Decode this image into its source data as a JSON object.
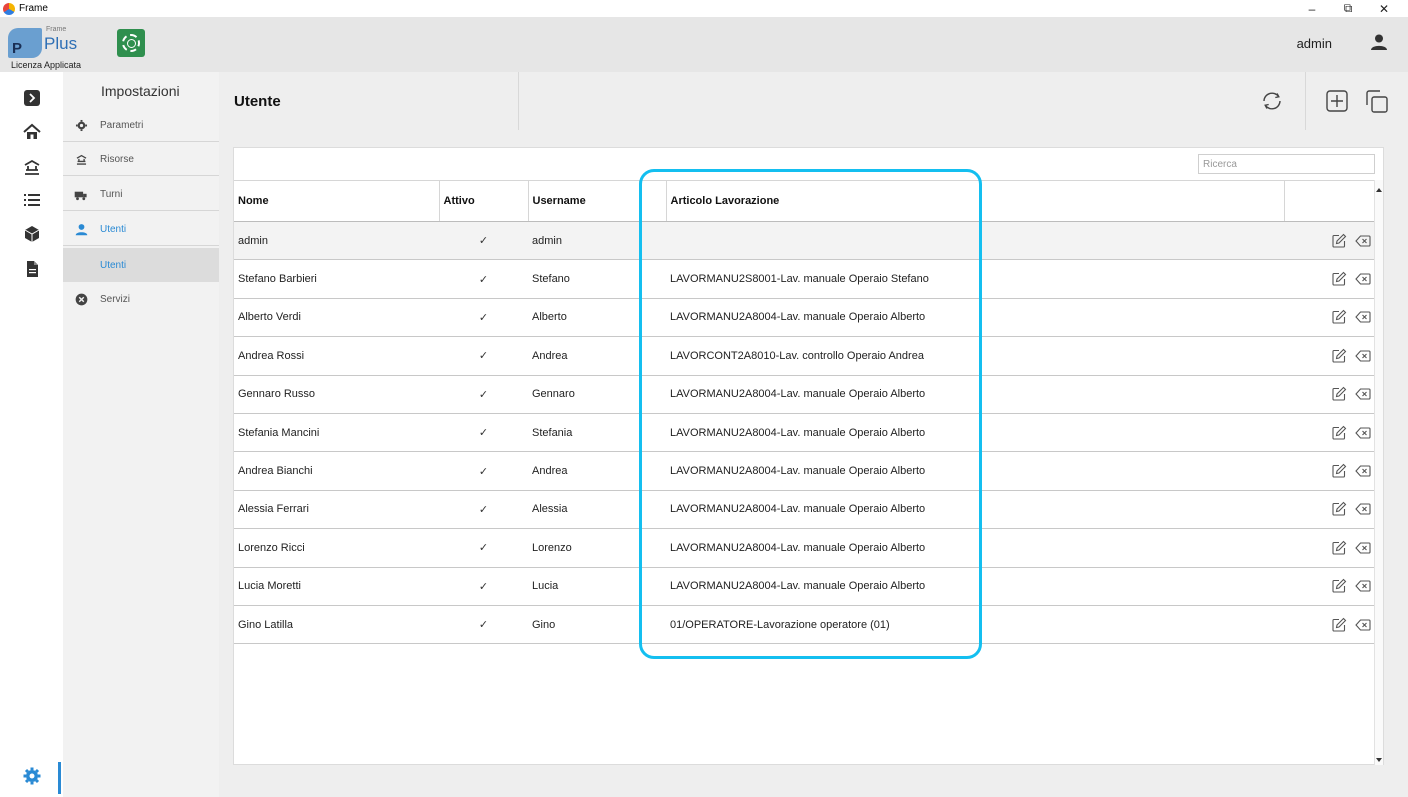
{
  "window": {
    "title": "Frame",
    "icon": "app-icon",
    "controls": {
      "minimize": "–",
      "restore": "⧉",
      "close": "✕"
    }
  },
  "header": {
    "logo_small": "Frame",
    "logo_letter": "P",
    "logo_text": "Plus",
    "license": "Licenza Applicata",
    "user_name": "admin",
    "green_button_icon": "wheel-icon",
    "user_icon": "user-icon"
  },
  "rail": {
    "icons": [
      "chevron-right-icon",
      "home-icon",
      "resources-icon",
      "list-icon",
      "box-icon",
      "document-icon"
    ],
    "bottom_icon": "gear-icon"
  },
  "submenu": {
    "title": "Impostazioni",
    "items": [
      {
        "label": "Parametri",
        "icon": "gear-icon"
      },
      {
        "label": "Risorse",
        "icon": "resources-icon"
      },
      {
        "label": "Turni",
        "icon": "shift-icon"
      },
      {
        "label": "Utenti",
        "icon": "user-icon"
      },
      {
        "label": "Servizi",
        "icon": "services-icon"
      }
    ],
    "sub_item": "Utenti"
  },
  "page": {
    "title": "Utente",
    "actions": [
      "refresh-icon",
      "add-icon",
      "copy-icon"
    ]
  },
  "search": {
    "placeholder": "Ricerca",
    "value": ""
  },
  "table": {
    "columns": [
      "Nome",
      "Attivo",
      "Username",
      "Articolo Lavorazione",
      ""
    ],
    "rows": [
      {
        "nome": "admin",
        "attivo": "✓",
        "username": "admin",
        "articolo": ""
      },
      {
        "nome": "Stefano Barbieri",
        "attivo": "✓",
        "username": "Stefano",
        "articolo": "LAVORMANU2S8001-Lav. manuale Operaio Stefano"
      },
      {
        "nome": "Alberto Verdi",
        "attivo": "✓",
        "username": "Alberto",
        "articolo": "LAVORMANU2A8004-Lav. manuale Operaio Alberto"
      },
      {
        "nome": "Andrea Rossi",
        "attivo": "✓",
        "username": "Andrea",
        "articolo": "LAVORCONT2A8010-Lav. controllo Operaio Andrea"
      },
      {
        "nome": "Gennaro Russo",
        "attivo": "✓",
        "username": "Gennaro",
        "articolo": "LAVORMANU2A8004-Lav. manuale Operaio Alberto"
      },
      {
        "nome": "Stefania Mancini",
        "attivo": "✓",
        "username": "Stefania",
        "articolo": "LAVORMANU2A8004-Lav. manuale Operaio Alberto"
      },
      {
        "nome": "Andrea Bianchi",
        "attivo": "✓",
        "username": "Andrea",
        "articolo": "LAVORMANU2A8004-Lav. manuale Operaio Alberto"
      },
      {
        "nome": "Alessia Ferrari",
        "attivo": "✓",
        "username": "Alessia",
        "articolo": "LAVORMANU2A8004-Lav. manuale Operaio Alberto"
      },
      {
        "nome": "Lorenzo Ricci",
        "attivo": "✓",
        "username": "Lorenzo",
        "articolo": "LAVORMANU2A8004-Lav. manuale Operaio Alberto"
      },
      {
        "nome": "Lucia Moretti",
        "attivo": "✓",
        "username": "Lucia",
        "articolo": "LAVORMANU2A8004-Lav. manuale Operaio Alberto"
      },
      {
        "nome": "Gino Latilla",
        "attivo": "✓",
        "username": "Gino",
        "articolo": "01/OPERATORE-Lavorazione operatore (01)"
      }
    ],
    "row_actions": [
      "edit-icon",
      "delete-icon"
    ]
  },
  "colors": {
    "accent": "#2a8ad4",
    "highlight": "#14bff0",
    "brand_green": "#2f8f4e"
  }
}
